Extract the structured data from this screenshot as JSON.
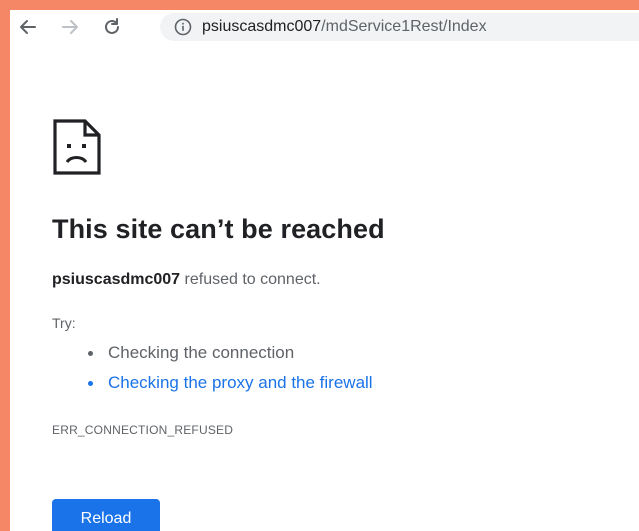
{
  "browser": {
    "icons": {
      "back": "arrow-left-icon",
      "forward": "arrow-right-icon",
      "reload": "reload-icon",
      "site_info": "info-icon"
    },
    "url_host": "psiuscasdmc007",
    "url_path": "/mdService1Rest/Index"
  },
  "error_page": {
    "icon": "sad-page-icon",
    "title": "This site can’t be reached",
    "host": "psiuscasdmc007",
    "message": " refused to connect.",
    "try_label": "Try:",
    "suggestions": [
      "Checking the connection",
      "Checking the proxy and the firewall"
    ],
    "error_code": "ERR_CONNECTION_REFUSED",
    "reload_label": "Reload"
  },
  "colors": {
    "border": "#f58766",
    "link": "#1a73e8",
    "button": "#1a73e8"
  }
}
